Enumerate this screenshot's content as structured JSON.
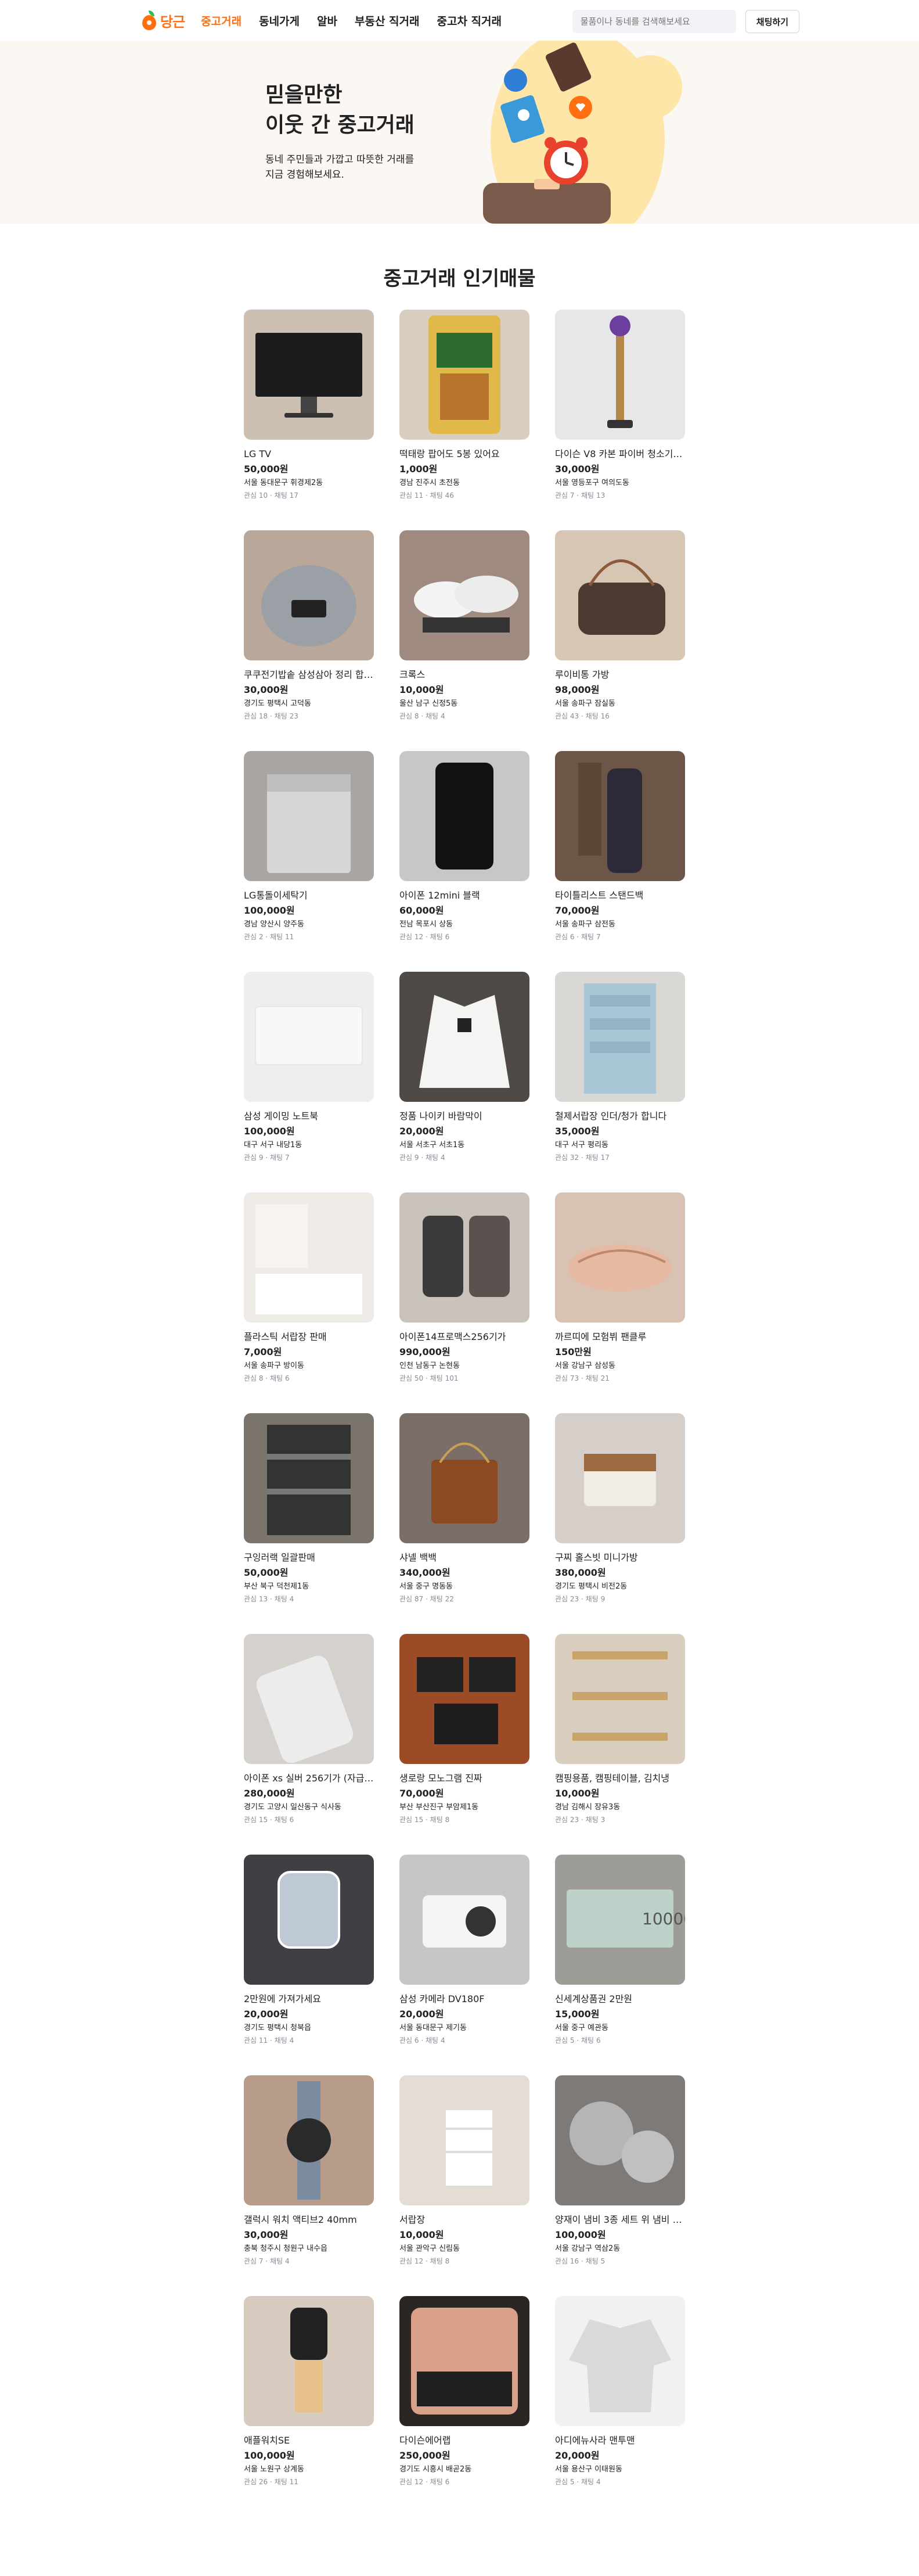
{
  "header": {
    "logo_text": "당근",
    "nav": [
      "중고거래",
      "동네가게",
      "알바",
      "부동산 직거래",
      "중고차 직거래"
    ],
    "search_placeholder": "물품이나 동네를 검색해보세요",
    "chat_button": "채팅하기"
  },
  "hero": {
    "title_line1": "믿을만한",
    "title_line2": "이웃 간 중고거래",
    "desc_line1": "동네 주민들과 가깝고 따뜻한 거래를",
    "desc_line2": "지금 경험해보세요."
  },
  "section_title": "중고거래 인기매물",
  "stat_labels": {
    "interest": "관심",
    "chat": "채팅",
    "sep": " · "
  },
  "products": [
    {
      "title": "LG TV",
      "price": "50,000원",
      "region": "서울 동대문구 휘경제2동",
      "interest": 10,
      "chat": 17,
      "bg": "#cdbfb2",
      "kind": "tv"
    },
    {
      "title": "떡태랑 팝어도 5봉 있어요",
      "price": "1,000원",
      "region": "경남 진주시 초전동",
      "interest": 11,
      "chat": 46,
      "bg": "#d8cdbf",
      "kind": "snack"
    },
    {
      "title": "다이슨 V8 카본 파이버 청소기 팝...",
      "price": "30,000원",
      "region": "서울 영등포구 여의도동",
      "interest": 7,
      "chat": 13,
      "bg": "#e7e7ea",
      "kind": "vacuum"
    },
    {
      "title": "쿠쿠전기밥솥 삼성삼아 정리 합니다.",
      "price": "30,000원",
      "region": "경기도 평택시 고덕동",
      "interest": 18,
      "chat": 23,
      "bg": "#b9a89a",
      "kind": "cooker"
    },
    {
      "title": "크록스",
      "price": "10,000원",
      "region": "울산 남구 신정5동",
      "interest": 8,
      "chat": 4,
      "bg": "#9f8a80",
      "kind": "crocs"
    },
    {
      "title": "루이비통 가방",
      "price": "98,000원",
      "region": "서울 송파구 잠실동",
      "interest": 43,
      "chat": 16,
      "bg": "#d8c6b5",
      "kind": "bag"
    },
    {
      "title": "LG통돌이세탁기",
      "price": "100,000원",
      "region": "경남 양산시 양주동",
      "interest": 2,
      "chat": 11,
      "bg": "#a8a5a2",
      "kind": "washer"
    },
    {
      "title": "아이폰 12mini 블랙",
      "price": "60,000원",
      "region": "전남 목포시 상동",
      "interest": 12,
      "chat": 6,
      "bg": "#c9c7c5",
      "kind": "phone"
    },
    {
      "title": "타이틀리스트 스탠드백",
      "price": "70,000원",
      "region": "서울 송파구 삼전동",
      "interest": 6,
      "chat": 7,
      "bg": "#6b5647",
      "kind": "golf"
    },
    {
      "title": "삼성 게이밍 노트북",
      "price": "100,000원",
      "region": "대구 서구 내당1동",
      "interest": 9,
      "chat": 7,
      "bg": "#eeeeec",
      "kind": "laptop"
    },
    {
      "title": "정품 나이키 바람막이",
      "price": "20,000원",
      "region": "서울 서초구 서초1동",
      "interest": 9,
      "chat": 4,
      "bg": "#4f4a46",
      "kind": "jacket"
    },
    {
      "title": "철제서랍장 인더/청가 합니다",
      "price": "35,000원",
      "region": "대구 서구 평리동",
      "interest": 32,
      "chat": 17,
      "bg": "#d9d8d4",
      "kind": "drawer"
    },
    {
      "title": "플라스틱 서랍장 판매",
      "price": "7,000원",
      "region": "서울 송파구 방이동",
      "interest": 8,
      "chat": 6,
      "bg": "#eeebe6",
      "kind": "shelf"
    },
    {
      "title": "아이폰14프로맥스256기가",
      "price": "990,000원",
      "region": "인천 남동구 논현동",
      "interest": 50,
      "chat": 101,
      "bg": "#c9c3bc",
      "kind": "iphone14"
    },
    {
      "title": "까르띠에 모험뷔 팬클루",
      "price": "150만원",
      "region": "서울 강남구 삼성동",
      "interest": 73,
      "chat": 21,
      "bg": "#d8c2b4",
      "kind": "bracelet"
    },
    {
      "title": "구잉러랙 일괄판매",
      "price": "50,000원",
      "region": "부산 북구 덕천제1동",
      "interest": 13,
      "chat": 4,
      "bg": "#7a746d",
      "kind": "rack"
    },
    {
      "title": "샤넬 백백",
      "price": "340,000원",
      "region": "서울 중구 명동동",
      "interest": 87,
      "chat": 22,
      "bg": "#7b6e68",
      "kind": "chanel"
    },
    {
      "title": "구찌 홀스빗 미니가방",
      "price": "380,000원",
      "region": "경기도 평택시 비전2동",
      "interest": 23,
      "chat": 9,
      "bg": "#d6cec8",
      "kind": "gucci"
    },
    {
      "title": "아이폰 xs 실버 256기가 (자급제)",
      "price": "280,000원",
      "region": "경기도 고양시 일산동구 식사동",
      "interest": 15,
      "chat": 6,
      "bg": "#d5d2ce",
      "kind": "iphonexs"
    },
    {
      "title": "생로랑 모노그램 진짜",
      "price": "70,000원",
      "region": "부산 부산진구 부암제1동",
      "interest": 15,
      "chat": 8,
      "bg": "#9b4b26",
      "kind": "wallet"
    },
    {
      "title": "캠핑용품, 캠핑테이블, 김치냉",
      "price": "10,000원",
      "region": "경남 김해시 장유3동",
      "interest": 23,
      "chat": 3,
      "bg": "#d9cdbd",
      "kind": "camping"
    },
    {
      "title": "2만원에 가져가세요",
      "price": "20,000원",
      "region": "경기도 평택시 청북읍",
      "interest": 11,
      "chat": 4,
      "bg": "#3f3f44",
      "kind": "mirror"
    },
    {
      "title": "삼성 카메라 DV180F",
      "price": "20,000원",
      "region": "서울 동대문구 제기동",
      "interest": 6,
      "chat": 4,
      "bg": "#c8c6c5",
      "kind": "camera"
    },
    {
      "title": "신세계상품권 2만원",
      "price": "15,000원",
      "region": "서울 중구 예관동",
      "interest": 5,
      "chat": 6,
      "bg": "#9e9c96",
      "kind": "gift"
    },
    {
      "title": "갤럭시 워치 액티브2 40mm",
      "price": "30,000원",
      "region": "충북 청주시 청원구 내수읍",
      "interest": 7,
      "chat": 4,
      "bg": "#b79d89",
      "kind": "watch"
    },
    {
      "title": "서랍장",
      "price": "10,000원",
      "region": "서울 관악구 신림동",
      "interest": 12,
      "chat": 8,
      "bg": "#e3ddd6",
      "kind": "dresser"
    },
    {
      "title": "양재이 냄비 3종 세트 위 냄비 무...",
      "price": "100,000원",
      "region": "서울 강남구 역삼2동",
      "interest": 16,
      "chat": 5,
      "bg": "#7e7a77",
      "kind": "pots"
    },
    {
      "title": "애플워치SE",
      "price": "100,000원",
      "region": "서울 노원구 상계동",
      "interest": 26,
      "chat": 11,
      "bg": "#d7cbbf",
      "kind": "applewatch"
    },
    {
      "title": "다이슨에어랩",
      "price": "250,000원",
      "region": "경기도 시흥시 배곧2동",
      "interest": 12,
      "chat": 6,
      "bg": "#2b2623",
      "kind": "airwrap"
    },
    {
      "title": "아디에뉴사라 맨투맨",
      "price": "20,000원",
      "region": "서울 용산구 이태원동",
      "interest": 5,
      "chat": 4,
      "bg": "#f1f1f1",
      "kind": "sweatshirt"
    }
  ]
}
